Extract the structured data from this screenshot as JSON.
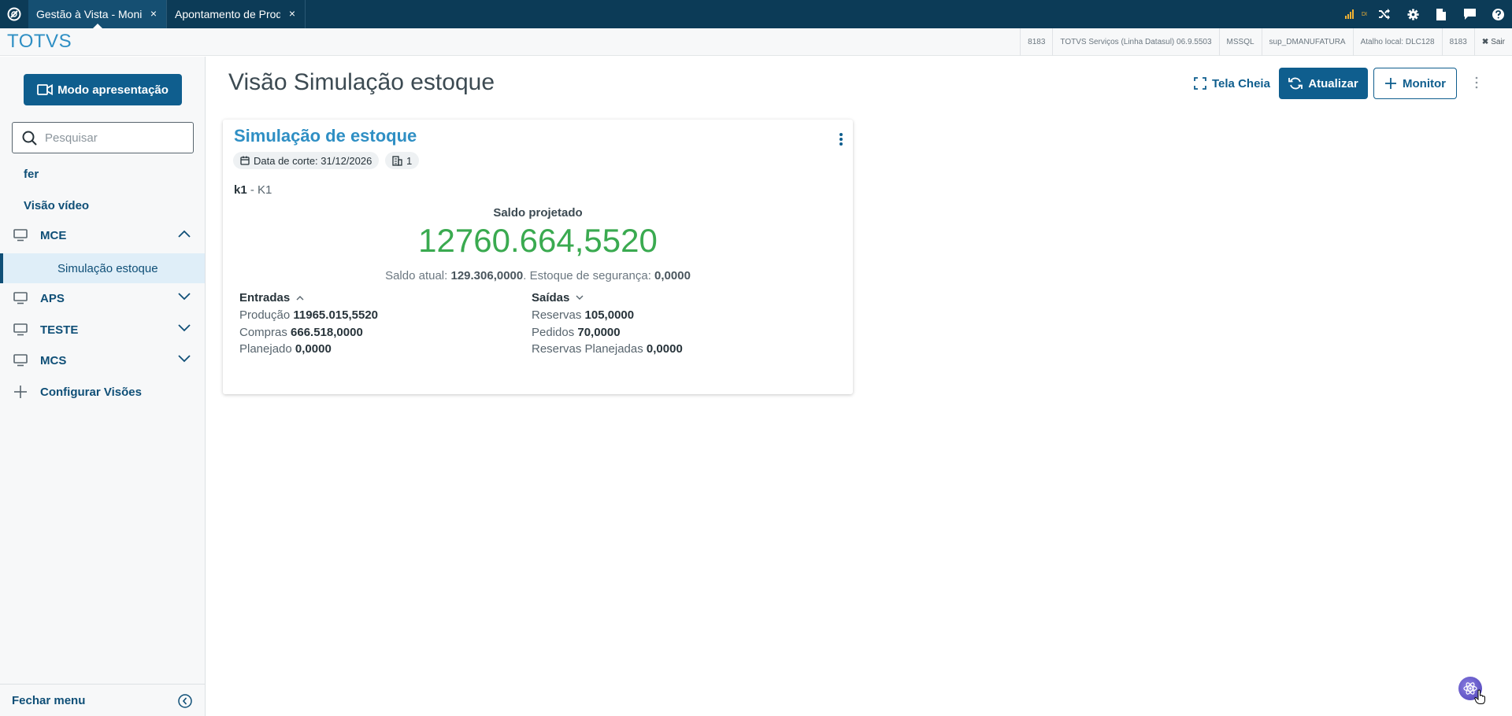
{
  "tabs": [
    {
      "label": "Gestão à Vista - Monit",
      "close": "×",
      "active": true
    },
    {
      "label": "Apontamento de Produ",
      "close": "×",
      "active": false
    }
  ],
  "top_icons": [
    "signal-icon",
    "shuffle-icon",
    "gear-icon",
    "document-icon",
    "chat-icon",
    "help-icon"
  ],
  "signal_text": "DI",
  "brand": "TOTVS",
  "info": [
    "8183",
    "TOTVS Serviços (Linha Datasul) 06.9.5503",
    "MSSQL",
    "sup_DMANUFATURA",
    "Atalho local: DLC128",
    "8183"
  ],
  "logout": "Sair",
  "sidebar": {
    "present_button": "Modo apresentação",
    "search_placeholder": "Pesquisar",
    "items": [
      {
        "label": "fer"
      },
      {
        "label": "Visão vídeo"
      },
      {
        "label": "MCE",
        "expanded": true,
        "children": [
          "Simulação estoque"
        ]
      },
      {
        "label": "APS",
        "expanded": false
      },
      {
        "label": "TESTE",
        "expanded": false
      },
      {
        "label": "MCS",
        "expanded": false
      }
    ],
    "configure": "Configurar Visões",
    "close_menu": "Fechar menu"
  },
  "main": {
    "title": "Visão Simulação estoque",
    "actions": {
      "fullscreen": "Tela Cheia",
      "refresh": "Atualizar",
      "monitor": "Monitor"
    }
  },
  "card": {
    "title": "Simulação de estoque",
    "date_chip": "Data de corte: 31/12/2026",
    "count_chip": "1",
    "item_code": "k1",
    "item_sep": " - ",
    "item_name": "K1",
    "saldo_label": "Saldo projetado",
    "saldo_value": "12760.664,5520",
    "saldo_atual_label": "Saldo atual: ",
    "saldo_atual_value": "129.306,0000",
    "estoque_label": ". Estoque de segurança: ",
    "estoque_value": "0,0000",
    "entradas": {
      "title": "Entradas",
      "rows": [
        {
          "label": "Produção ",
          "value": "11965.015,5520"
        },
        {
          "label": "Compras ",
          "value": "666.518,0000"
        },
        {
          "label": "Planejado ",
          "value": "0,0000"
        }
      ]
    },
    "saidas": {
      "title": "Saídas",
      "rows": [
        {
          "label": "Reservas ",
          "value": "105,0000"
        },
        {
          "label": "Pedidos ",
          "value": "70,0000"
        },
        {
          "label": "Reservas Planejadas ",
          "value": "0,0000"
        }
      ]
    }
  },
  "colors": {
    "primary": "#0f5e8e",
    "topbar": "#0c3b57",
    "brand": "#2f8fc4",
    "saldo": "#3aaa50"
  }
}
